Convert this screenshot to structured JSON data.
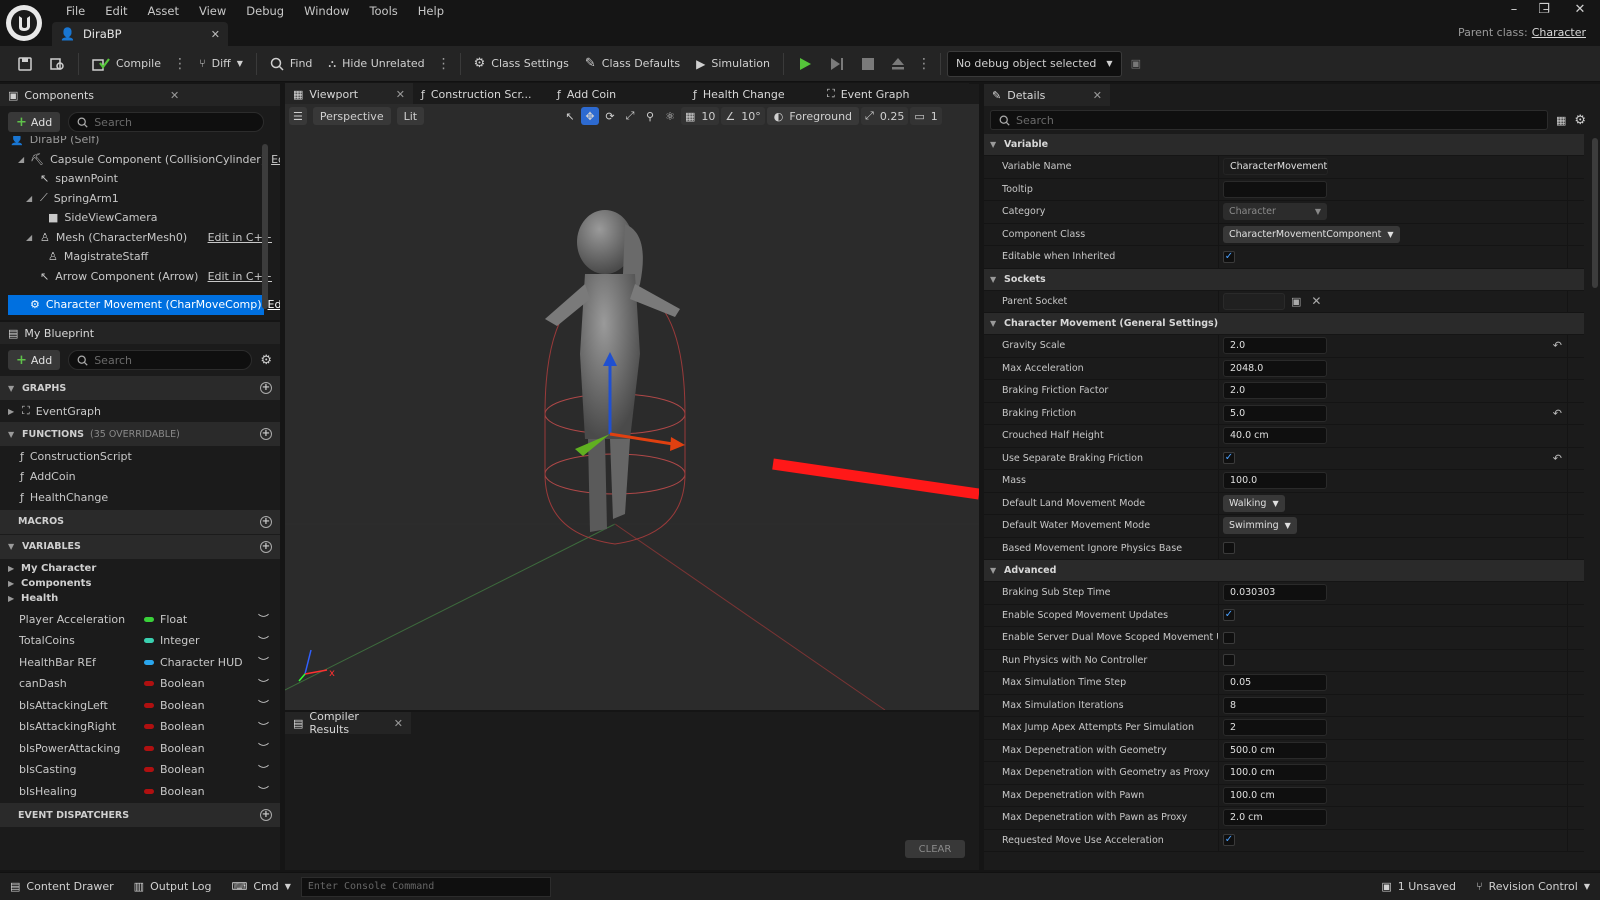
{
  "menu": [
    "File",
    "Edit",
    "Asset",
    "View",
    "Debug",
    "Window",
    "Tools",
    "Help"
  ],
  "doc_tab": {
    "name": "DiraBP"
  },
  "parent_class": {
    "label": "Parent class:",
    "value": "Character"
  },
  "toolbar": {
    "compile": "Compile",
    "diff": "Diff",
    "find": "Find",
    "hide_unrelated": "Hide Unrelated",
    "class_settings": "Class Settings",
    "class_defaults": "Class Defaults",
    "simulation": "Simulation",
    "debug_select": "No debug object selected"
  },
  "components": {
    "tab": "Components",
    "add": "Add",
    "search_placeholder": "Search",
    "root": "DiraBP (Self)",
    "items": [
      {
        "label": "Capsule Component (CollisionCylinder)",
        "edit": "Edit i"
      },
      {
        "label": "spawnPoint",
        "edit": ""
      },
      {
        "label": "SpringArm1",
        "edit": ""
      },
      {
        "label": "SideViewCamera",
        "edit": ""
      },
      {
        "label": "Mesh (CharacterMesh0)",
        "edit": "Edit in C++"
      },
      {
        "label": "MagistrateStaff",
        "edit": ""
      },
      {
        "label": "Arrow Component (Arrow)",
        "edit": "Edit in C++"
      }
    ],
    "selected": {
      "label": "Character Movement (CharMoveComp)",
      "edit": "Edit"
    }
  },
  "my_blueprint": {
    "tab": "My Blueprint",
    "add": "Add",
    "search_placeholder": "Search",
    "sections": {
      "graphs": "GRAPHS",
      "functions": "FUNCTIONS",
      "functions_sub": "(35 OVERRIDABLE)",
      "macros": "MACROS",
      "variables": "VARIABLES",
      "event_dispatchers": "EVENT DISPATCHERS"
    },
    "graphs": [
      "EventGraph"
    ],
    "functions": [
      "ConstructionScript",
      "AddCoin",
      "HealthChange"
    ],
    "var_categories": [
      "My Character",
      "Components",
      "Health"
    ],
    "variables": [
      {
        "name": "Player Acceleration",
        "type": "Float",
        "color": "#39d13a"
      },
      {
        "name": "TotalCoins",
        "type": "Integer",
        "color": "#3ad0b0"
      },
      {
        "name": "HealthBar REf",
        "type": "Character HUD",
        "color": "#2aa6ee"
      },
      {
        "name": "canDash",
        "type": "Boolean",
        "color": "#b01010"
      },
      {
        "name": "bIsAttackingLeft",
        "type": "Boolean",
        "color": "#b01010"
      },
      {
        "name": "bIsAttackingRight",
        "type": "Boolean",
        "color": "#b01010"
      },
      {
        "name": "bIsPowerAttacking",
        "type": "Boolean",
        "color": "#b01010"
      },
      {
        "name": "bIsCasting",
        "type": "Boolean",
        "color": "#b01010"
      },
      {
        "name": "bIsHealing",
        "type": "Boolean",
        "color": "#b01010"
      }
    ]
  },
  "editor_tabs": [
    "Viewport",
    "Construction Scr...",
    "Add Coin",
    "Health Change",
    "Event Graph"
  ],
  "viewport": {
    "perspective": "Perspective",
    "lit": "Lit",
    "grid_size": "10",
    "rot_snap": "10°",
    "foreground": "Foreground",
    "scale_snap": "0.25",
    "camera_speed": "1"
  },
  "compiler": {
    "tab": "Compiler Results",
    "clear": "CLEAR"
  },
  "details": {
    "tab": "Details",
    "search_placeholder": "Search",
    "sections": [
      {
        "title": "Variable",
        "rows": [
          {
            "label": "Variable Name",
            "kind": "text",
            "value": "CharacterMovement"
          },
          {
            "label": "Tooltip",
            "kind": "field",
            "value": ""
          },
          {
            "label": "Category",
            "kind": "combo-dim",
            "value": "Character"
          },
          {
            "label": "Component Class",
            "kind": "combo",
            "value": "CharacterMovementComponent"
          },
          {
            "label": "Editable when Inherited",
            "kind": "check",
            "value": "✓"
          }
        ]
      },
      {
        "title": "Sockets",
        "rows": [
          {
            "label": "Parent Socket",
            "kind": "socket",
            "value": ""
          }
        ]
      },
      {
        "title": "Character Movement (General Settings)",
        "rows": [
          {
            "label": "Gravity Scale",
            "kind": "field",
            "value": "2.0",
            "reset": true
          },
          {
            "label": "Max Acceleration",
            "kind": "field",
            "value": "2048.0"
          },
          {
            "label": "Braking Friction Factor",
            "kind": "field",
            "value": "2.0"
          },
          {
            "label": "Braking Friction",
            "kind": "field",
            "value": "5.0",
            "reset": true
          },
          {
            "label": "Crouched Half Height",
            "kind": "field",
            "value": "40.0 cm"
          },
          {
            "label": "Use Separate Braking Friction",
            "kind": "check",
            "value": "✓",
            "reset": true
          },
          {
            "label": "Mass",
            "kind": "field",
            "value": "100.0"
          },
          {
            "label": "Default Land Movement Mode",
            "kind": "combo",
            "value": "Walking"
          },
          {
            "label": "Default Water Movement Mode",
            "kind": "combo",
            "value": "Swimming"
          },
          {
            "label": "Based Movement Ignore Physics Base",
            "kind": "check",
            "value": ""
          }
        ]
      },
      {
        "title": "Advanced",
        "rows": [
          {
            "label": "Braking Sub Step Time",
            "kind": "field",
            "value": "0.030303"
          },
          {
            "label": "Enable Scoped Movement Updates",
            "kind": "check",
            "value": "✓"
          },
          {
            "label": "Enable Server Dual Move Scoped Movement Updat...",
            "kind": "check",
            "value": ""
          },
          {
            "label": "Run Physics with No Controller",
            "kind": "check",
            "value": ""
          },
          {
            "label": "Max Simulation Time Step",
            "kind": "field",
            "value": "0.05"
          },
          {
            "label": "Max Simulation Iterations",
            "kind": "field",
            "value": "8"
          },
          {
            "label": "Max Jump Apex Attempts Per Simulation",
            "kind": "field",
            "value": "2"
          },
          {
            "label": "Max Depenetration with Geometry",
            "kind": "field",
            "value": "500.0 cm"
          },
          {
            "label": "Max Depenetration with Geometry as Proxy",
            "kind": "field",
            "value": "100.0 cm"
          },
          {
            "label": "Max Depenetration with Pawn",
            "kind": "field",
            "value": "100.0 cm"
          },
          {
            "label": "Max Depenetration with Pawn as Proxy",
            "kind": "field",
            "value": "2.0 cm"
          },
          {
            "label": "Requested Move Use Acceleration",
            "kind": "check",
            "value": "✓"
          }
        ]
      }
    ]
  },
  "statusbar": {
    "content_drawer": "Content Drawer",
    "output_log": "Output Log",
    "cmd": "Cmd",
    "console_placeholder": "Enter Console Command",
    "unsaved": "1 Unsaved",
    "revision_control": "Revision Control"
  },
  "colors": {
    "accent": "#0070e0",
    "play": "#55c43a",
    "x_axis": "#ff2020"
  }
}
